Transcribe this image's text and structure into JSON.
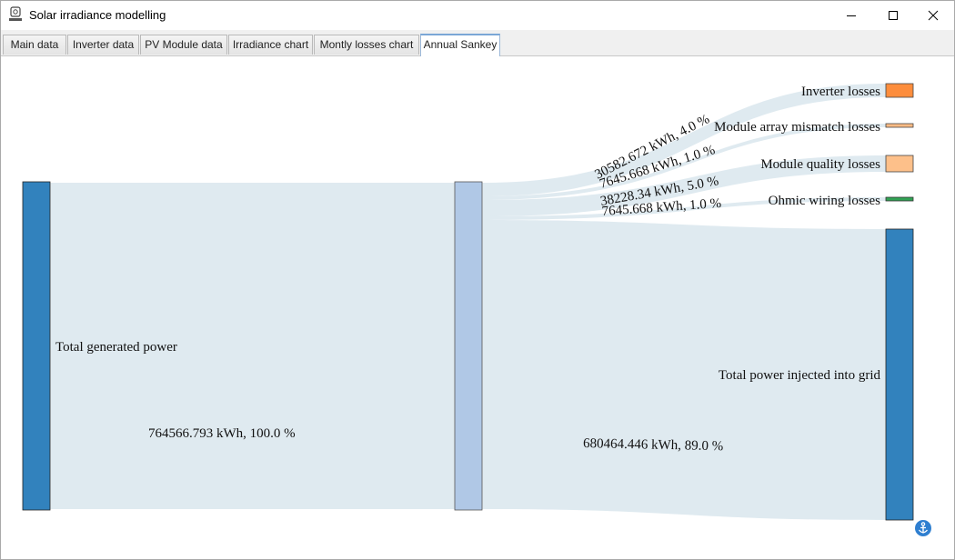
{
  "window": {
    "title": "Solar irradiance modelling"
  },
  "tabs": [
    {
      "label": "Main data"
    },
    {
      "label": "Inverter data"
    },
    {
      "label": "PV Module data"
    },
    {
      "label": "Irradiance chart"
    },
    {
      "label": "Montly losses chart"
    },
    {
      "label": "Annual Sankey"
    }
  ],
  "active_tab": "Annual Sankey",
  "colors": {
    "source_node": "#3282bd",
    "middle_node": "#b0c8e6",
    "sink_node": "#3282bd",
    "link": "#dde9ef",
    "inverter_losses": "#fd8d3c",
    "module_array_mismatch": "#fdbb84",
    "module_quality": "#fdc08a",
    "ohmic_wiring": "#31a354"
  },
  "sankey": {
    "nodes": {
      "total_generated": "Total generated power",
      "inverter_losses": "Inverter losses",
      "module_array_mismatch_losses": "Module array mismatch losses",
      "module_quality_losses": "Module quality losses",
      "ohmic_wiring_losses": "Ohmic wiring losses",
      "total_injected": "Total power injected into grid"
    },
    "links": {
      "generated_to_middle": "764566.793 kWh, 100.0 %",
      "inverter": "30582.672 kWh, 4.0 %",
      "mismatch": "7645.668 kWh, 1.0 %",
      "quality": "38228.34 kWh, 5.0 %",
      "ohmic": "7645.668 kWh, 1.0 %",
      "injected": "680464.446 kWh, 89.0 %"
    }
  }
}
